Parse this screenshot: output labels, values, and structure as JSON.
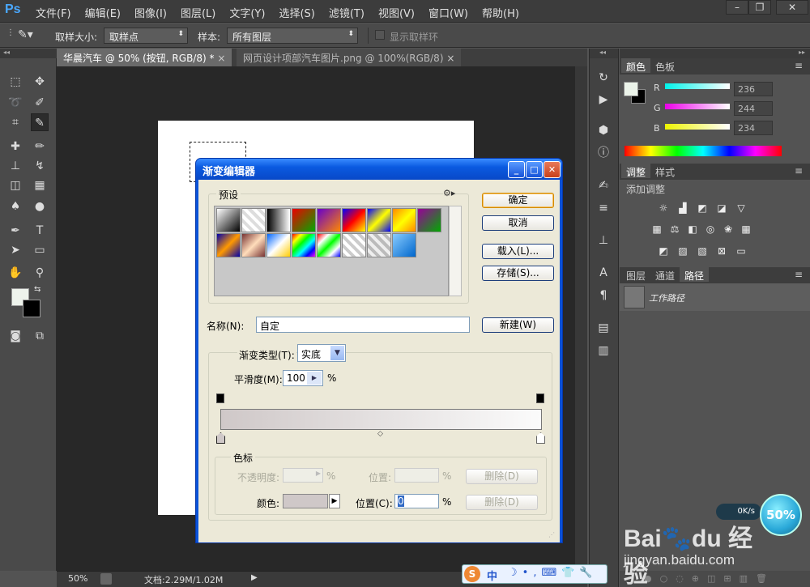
{
  "app": {
    "logo": "Ps"
  },
  "menu": [
    "文件(F)",
    "编辑(E)",
    "图像(I)",
    "图层(L)",
    "文字(Y)",
    "选择(S)",
    "滤镜(T)",
    "视图(V)",
    "窗口(W)",
    "帮助(H)"
  ],
  "options": {
    "sample_size_label": "取样大小:",
    "sample_size_value": "取样点",
    "sample_label": "样本:",
    "sample_value": "所有图层",
    "show_ring_label": "显示取样环"
  },
  "tabs": [
    {
      "label": "华晨汽车 @ 50% (按钮, RGB/8) *"
    },
    {
      "label": "网页设计项部汽车图片.png @ 100%(RGB/8)"
    }
  ],
  "status": {
    "zoom": "50%",
    "doc": "文档:2.29M/1.02M"
  },
  "color_panel": {
    "tabs": [
      "颜色",
      "色板"
    ],
    "r": "236",
    "g": "244",
    "b": "234",
    "r_label": "R",
    "g_label": "G",
    "b_label": "B"
  },
  "adjust_panel": {
    "tabs": [
      "调整",
      "样式"
    ],
    "add_label": "添加调整"
  },
  "layers_panel": {
    "tabs": [
      "图层",
      "通道",
      "路径"
    ],
    "item": "工作路径"
  },
  "dialog": {
    "title": "渐变编辑器",
    "presets_label": "预设",
    "ok": "确定",
    "cancel": "取消",
    "load": "载入(L)...",
    "save": "存储(S)...",
    "name_label": "名称(N):",
    "name_value": "自定",
    "new": "新建(W)",
    "type_label": "渐变类型(T):",
    "type_value": "实底",
    "smooth_label": "平滑度(M):",
    "smooth_value": "100",
    "percent": "%",
    "stops_label": "色标",
    "opacity_label": "不透明度:",
    "position_label1": "位置:",
    "delete1": "删除(D)",
    "color_label": "颜色:",
    "position_label2": "位置(C):",
    "position_value": "0",
    "delete2": "删除(D)"
  },
  "watermark": {
    "speed": "0K/s",
    "percent": "50%",
    "site": "jingyan.baidu.com"
  },
  "ime": {
    "label": "中"
  }
}
